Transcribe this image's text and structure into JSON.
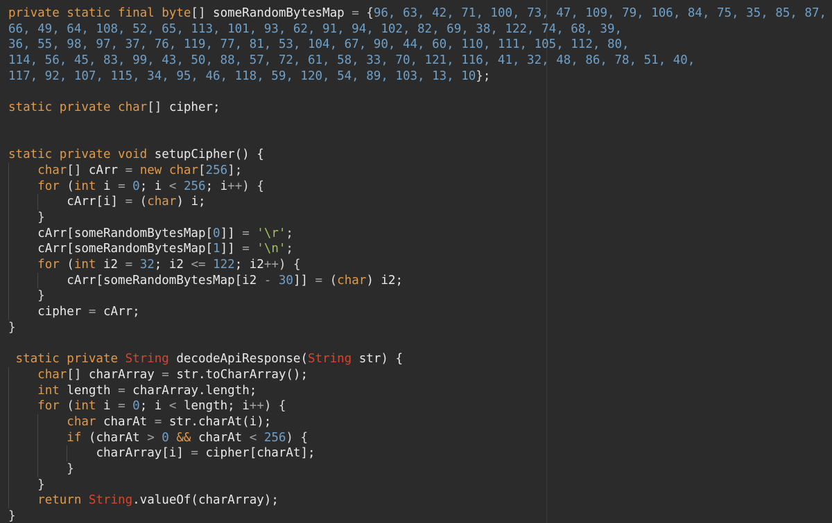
{
  "editor": {
    "lines": [
      {
        "indent": 0,
        "tokens": [
          {
            "t": "private static final ",
            "c": "kw"
          },
          {
            "t": "byte",
            "c": "kw"
          },
          {
            "t": "[] ",
            "c": "punc"
          },
          {
            "t": "someRandomBytesMap ",
            "c": "id"
          },
          {
            "t": "= ",
            "c": "op"
          },
          {
            "t": "{",
            "c": "punc"
          },
          {
            "t": "96, 63, 42, 71, 100, 73, 47, 109, 79, 106, 84, 75, 35, 85, 87,",
            "c": "num"
          }
        ]
      },
      {
        "indent": 0,
        "tokens": [
          {
            "t": "66, 49, 64, 108, 52, 65, 113, 101, 93, 62, 91, 94, 102, 82, 69, 38, 122, 74, 68, 39,",
            "c": "num"
          }
        ]
      },
      {
        "indent": 0,
        "tokens": [
          {
            "t": "36, 55, 98, 97, 37, 76, 119, 77, 81, 53, 104, 67, 90, 44, 60, 110, 111, 105, 112, 80,",
            "c": "num"
          }
        ]
      },
      {
        "indent": 0,
        "tokens": [
          {
            "t": "114, 56, 45, 83, 99, 43, 50, 88, 57, 72, 61, 58, 33, 70, 121, 116, 41, 32, 48, 86, 78, 51, 40,",
            "c": "num"
          }
        ]
      },
      {
        "indent": 0,
        "tokens": [
          {
            "t": "117, 92, 107, 115, 34, 95, 46, 118, 59, 120, 54, 89, 103, 13, 10",
            "c": "num"
          },
          {
            "t": "};",
            "c": "punc"
          }
        ]
      },
      {
        "indent": 0,
        "tokens": []
      },
      {
        "indent": 0,
        "tokens": [
          {
            "t": "static private ",
            "c": "kw"
          },
          {
            "t": "char",
            "c": "kw"
          },
          {
            "t": "[] ",
            "c": "punc"
          },
          {
            "t": "cipher;",
            "c": "id"
          }
        ]
      },
      {
        "indent": 0,
        "tokens": []
      },
      {
        "indent": 0,
        "tokens": []
      },
      {
        "indent": 0,
        "tokens": [
          {
            "t": "static private void ",
            "c": "kw"
          },
          {
            "t": "setupCipher() {",
            "c": "id"
          }
        ]
      },
      {
        "indent": 1,
        "tokens": [
          {
            "t": "    ",
            "c": "punc"
          },
          {
            "t": "char",
            "c": "kw"
          },
          {
            "t": "[] ",
            "c": "punc"
          },
          {
            "t": "cArr ",
            "c": "id"
          },
          {
            "t": "= ",
            "c": "op"
          },
          {
            "t": "new ",
            "c": "kw"
          },
          {
            "t": "char",
            "c": "kw"
          },
          {
            "t": "[",
            "c": "punc"
          },
          {
            "t": "256",
            "c": "num"
          },
          {
            "t": "];",
            "c": "punc"
          }
        ]
      },
      {
        "indent": 1,
        "tokens": [
          {
            "t": "    ",
            "c": "punc"
          },
          {
            "t": "for ",
            "c": "kw"
          },
          {
            "t": "(",
            "c": "punc"
          },
          {
            "t": "int ",
            "c": "kw"
          },
          {
            "t": "i ",
            "c": "id"
          },
          {
            "t": "= ",
            "c": "op"
          },
          {
            "t": "0",
            "c": "num"
          },
          {
            "t": "; i ",
            "c": "id"
          },
          {
            "t": "< ",
            "c": "op"
          },
          {
            "t": "256",
            "c": "num"
          },
          {
            "t": "; i",
            "c": "id"
          },
          {
            "t": "++",
            "c": "op"
          },
          {
            "t": ") {",
            "c": "punc"
          }
        ]
      },
      {
        "indent": 2,
        "tokens": [
          {
            "t": "        ",
            "c": "punc"
          },
          {
            "t": "cArr[i] ",
            "c": "id"
          },
          {
            "t": "= ",
            "c": "op"
          },
          {
            "t": "(",
            "c": "punc"
          },
          {
            "t": "char",
            "c": "kw"
          },
          {
            "t": ") i;",
            "c": "id"
          }
        ]
      },
      {
        "indent": 1,
        "tokens": [
          {
            "t": "    ",
            "c": "punc"
          },
          {
            "t": "}",
            "c": "punc"
          }
        ]
      },
      {
        "indent": 1,
        "tokens": [
          {
            "t": "    ",
            "c": "punc"
          },
          {
            "t": "cArr[someRandomBytesMap[",
            "c": "id"
          },
          {
            "t": "0",
            "c": "num"
          },
          {
            "t": "]] ",
            "c": "id"
          },
          {
            "t": "= ",
            "c": "op"
          },
          {
            "t": "'\\r'",
            "c": "str"
          },
          {
            "t": ";",
            "c": "punc"
          }
        ]
      },
      {
        "indent": 1,
        "tokens": [
          {
            "t": "    ",
            "c": "punc"
          },
          {
            "t": "cArr[someRandomBytesMap[",
            "c": "id"
          },
          {
            "t": "1",
            "c": "num"
          },
          {
            "t": "]] ",
            "c": "id"
          },
          {
            "t": "= ",
            "c": "op"
          },
          {
            "t": "'\\n'",
            "c": "str"
          },
          {
            "t": ";",
            "c": "punc"
          }
        ]
      },
      {
        "indent": 1,
        "tokens": [
          {
            "t": "    ",
            "c": "punc"
          },
          {
            "t": "for ",
            "c": "kw"
          },
          {
            "t": "(",
            "c": "punc"
          },
          {
            "t": "int ",
            "c": "kw"
          },
          {
            "t": "i2 ",
            "c": "id"
          },
          {
            "t": "= ",
            "c": "op"
          },
          {
            "t": "32",
            "c": "num"
          },
          {
            "t": "; i2 ",
            "c": "id"
          },
          {
            "t": "<= ",
            "c": "op"
          },
          {
            "t": "122",
            "c": "num"
          },
          {
            "t": "; i2",
            "c": "id"
          },
          {
            "t": "++",
            "c": "op"
          },
          {
            "t": ") {",
            "c": "punc"
          }
        ]
      },
      {
        "indent": 2,
        "tokens": [
          {
            "t": "        ",
            "c": "punc"
          },
          {
            "t": "cArr[someRandomBytesMap[i2 ",
            "c": "id"
          },
          {
            "t": "- ",
            "c": "op"
          },
          {
            "t": "30",
            "c": "num"
          },
          {
            "t": "]] ",
            "c": "id"
          },
          {
            "t": "= ",
            "c": "op"
          },
          {
            "t": "(",
            "c": "punc"
          },
          {
            "t": "char",
            "c": "kw"
          },
          {
            "t": ") i2;",
            "c": "id"
          }
        ]
      },
      {
        "indent": 1,
        "tokens": [
          {
            "t": "    ",
            "c": "punc"
          },
          {
            "t": "}",
            "c": "punc"
          }
        ]
      },
      {
        "indent": 1,
        "tokens": [
          {
            "t": "    ",
            "c": "punc"
          },
          {
            "t": "cipher ",
            "c": "id"
          },
          {
            "t": "= ",
            "c": "op"
          },
          {
            "t": "cArr;",
            "c": "id"
          }
        ]
      },
      {
        "indent": 0,
        "tokens": [
          {
            "t": "}",
            "c": "punc"
          }
        ]
      },
      {
        "indent": 0,
        "tokens": []
      },
      {
        "indent": 0,
        "tokens": [
          {
            "t": " static private ",
            "c": "kw"
          },
          {
            "t": "String ",
            "c": "typeRed"
          },
          {
            "t": "decodeApiResponse(",
            "c": "id"
          },
          {
            "t": "String ",
            "c": "typeRed"
          },
          {
            "t": "str) {",
            "c": "id"
          }
        ]
      },
      {
        "indent": 1,
        "tokens": [
          {
            "t": "    ",
            "c": "punc"
          },
          {
            "t": "char",
            "c": "kw"
          },
          {
            "t": "[] ",
            "c": "punc"
          },
          {
            "t": "charArray ",
            "c": "id"
          },
          {
            "t": "= ",
            "c": "op"
          },
          {
            "t": "str.toCharArray();",
            "c": "id"
          }
        ]
      },
      {
        "indent": 1,
        "tokens": [
          {
            "t": "    ",
            "c": "punc"
          },
          {
            "t": "int ",
            "c": "kw"
          },
          {
            "t": "length ",
            "c": "id"
          },
          {
            "t": "= ",
            "c": "op"
          },
          {
            "t": "charArray.length;",
            "c": "id"
          }
        ]
      },
      {
        "indent": 1,
        "tokens": [
          {
            "t": "    ",
            "c": "punc"
          },
          {
            "t": "for ",
            "c": "kw"
          },
          {
            "t": "(",
            "c": "punc"
          },
          {
            "t": "int ",
            "c": "kw"
          },
          {
            "t": "i ",
            "c": "id"
          },
          {
            "t": "= ",
            "c": "op"
          },
          {
            "t": "0",
            "c": "num"
          },
          {
            "t": "; i ",
            "c": "id"
          },
          {
            "t": "< ",
            "c": "op"
          },
          {
            "t": "length; i",
            "c": "id"
          },
          {
            "t": "++",
            "c": "op"
          },
          {
            "t": ") {",
            "c": "punc"
          }
        ]
      },
      {
        "indent": 2,
        "tokens": [
          {
            "t": "        ",
            "c": "punc"
          },
          {
            "t": "char ",
            "c": "kw"
          },
          {
            "t": "charAt ",
            "c": "id"
          },
          {
            "t": "= ",
            "c": "op"
          },
          {
            "t": "str.charAt(i);",
            "c": "id"
          }
        ]
      },
      {
        "indent": 2,
        "tokens": [
          {
            "t": "        ",
            "c": "punc"
          },
          {
            "t": "if ",
            "c": "kw"
          },
          {
            "t": "(charAt ",
            "c": "id"
          },
          {
            "t": "> ",
            "c": "op"
          },
          {
            "t": "0 ",
            "c": "num"
          },
          {
            "t": "&& ",
            "c": "kw"
          },
          {
            "t": "charAt ",
            "c": "id"
          },
          {
            "t": "< ",
            "c": "op"
          },
          {
            "t": "256",
            "c": "num"
          },
          {
            "t": ") {",
            "c": "punc"
          }
        ]
      },
      {
        "indent": 3,
        "tokens": [
          {
            "t": "            ",
            "c": "punc"
          },
          {
            "t": "charArray[i] ",
            "c": "id"
          },
          {
            "t": "= ",
            "c": "op"
          },
          {
            "t": "cipher[charAt];",
            "c": "id"
          }
        ]
      },
      {
        "indent": 2,
        "tokens": [
          {
            "t": "        ",
            "c": "punc"
          },
          {
            "t": "}",
            "c": "punc"
          }
        ]
      },
      {
        "indent": 1,
        "tokens": [
          {
            "t": "    ",
            "c": "punc"
          },
          {
            "t": "}",
            "c": "punc"
          }
        ]
      },
      {
        "indent": 1,
        "tokens": [
          {
            "t": "    ",
            "c": "punc"
          },
          {
            "t": "return ",
            "c": "kw"
          },
          {
            "t": "String",
            "c": "typeRed"
          },
          {
            "t": ".valueOf(charArray);",
            "c": "id"
          }
        ]
      },
      {
        "indent": 0,
        "tokens": [
          {
            "t": "}",
            "c": "punc"
          }
        ]
      }
    ]
  }
}
